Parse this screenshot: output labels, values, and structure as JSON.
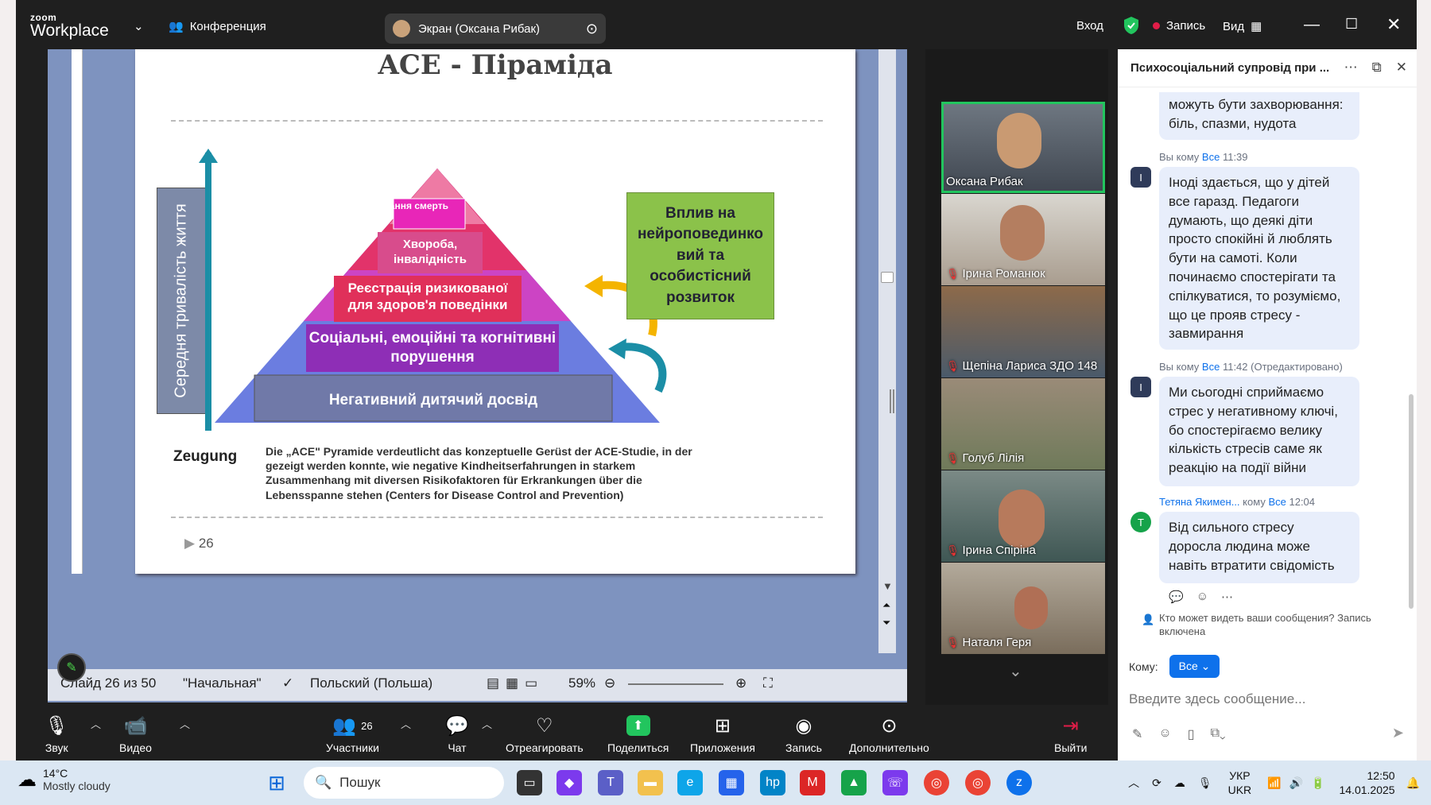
{
  "titlebar": {
    "logo_small": "zoom",
    "logo_big": "Workplace",
    "conference": "Конференция",
    "screen_share": "Экран (Оксана Рибак)",
    "login": "Вход",
    "record": "Запись",
    "view": "Вид"
  },
  "slide": {
    "title": "ACE - Піраміда",
    "side_label": "Середня тривалість життя",
    "levels": [
      "Рання смерть",
      "Хвороба, інвалідність",
      "Реєстрація ризикованої для здоров'я поведінки",
      "Соціальні, емоційні та когнітивні порушення",
      "Негативний дитячий досвід"
    ],
    "influence": "Вплив на нейроповединко вий та особистісний розвиток",
    "zeugung": "Zeugung",
    "description": "Die „ACE\" Pyramide verdeutlicht das konzeptuelle Gerüst der ACE-Studie, in der gezeigt werden konnte, wie negative Kindheitserfahrungen in starkem Zusammenhang mit diversen Risikofaktoren für Erkrankungen über die Lebensspanne stehen (Centers for Disease Control and Prevention)",
    "number": "26"
  },
  "status": {
    "slide_of": "Слайд 26 из 50",
    "design": "\"Начальная\"",
    "language": "Польский (Польша)",
    "zoom": "59%"
  },
  "participants": [
    {
      "name": "Оксана Рибак",
      "muted": false
    },
    {
      "name": "Ірина Романюк",
      "muted": true
    },
    {
      "name": "Щепіна Лариса ЗДО 148",
      "muted": true
    },
    {
      "name": "Голуб Лілія",
      "muted": true
    },
    {
      "name": "Ірина Спіріна",
      "muted": true
    },
    {
      "name": "Наталя Геря",
      "muted": true
    }
  ],
  "chat": {
    "title": "Психосоціальний супровід при ...",
    "partial_message": "можуть бути захворювання: біль, спазми, нудота",
    "messages": [
      {
        "from": "Вы",
        "mid": "кому",
        "to": "Все",
        "time": "11:39",
        "edited": "",
        "avatar": "I",
        "text": "Іноді здається, що у дітей все гаразд. Педагоги думають, що деякі діти просто спокійні й люблять бути на самоті. Коли починаємо спостерігати та спілкуватися, то розуміємо, що це прояв стресу - завмирання"
      },
      {
        "from": "Вы",
        "mid": "кому",
        "to": "Все",
        "time": "11:42",
        "edited": "(Отредактировано)",
        "avatar": "I",
        "text": "Ми сьогодні сприймаємо стрес у негативному ключі, бо спостерігаємо велику кількість стресів саме як реакцію на події  війни"
      },
      {
        "from": "Тетяна Якимен...",
        "mid": "кому",
        "to": "Все",
        "time": "12:04",
        "edited": "",
        "avatar": "T",
        "text": "Від сильного стресу доросла людина може навіть втратити свідомість"
      }
    ],
    "privacy": "Кто может видеть ваши сообщения? Запись включена",
    "to_label": "Кому:",
    "to_value": "Все",
    "input_placeholder": "Введите здесь сообщение..."
  },
  "toolbar": {
    "audio": "Звук",
    "video": "Видео",
    "participants": "Участники",
    "participants_count": "26",
    "chat": "Чат",
    "react": "Отреагировать",
    "share": "Поделиться",
    "apps": "Приложения",
    "record": "Запись",
    "more": "Дополнительно",
    "leave": "Выйти"
  },
  "taskbar": {
    "temp": "14°C",
    "weather": "Mostly cloudy",
    "search": "Пошук",
    "lang1": "УКР",
    "lang2": "UKR",
    "time": "12:50",
    "date": "14.01.2025"
  },
  "colors": {
    "accent": "#0e71eb",
    "active_speaker": "#22c55e",
    "record_dot": "#e11d48"
  }
}
